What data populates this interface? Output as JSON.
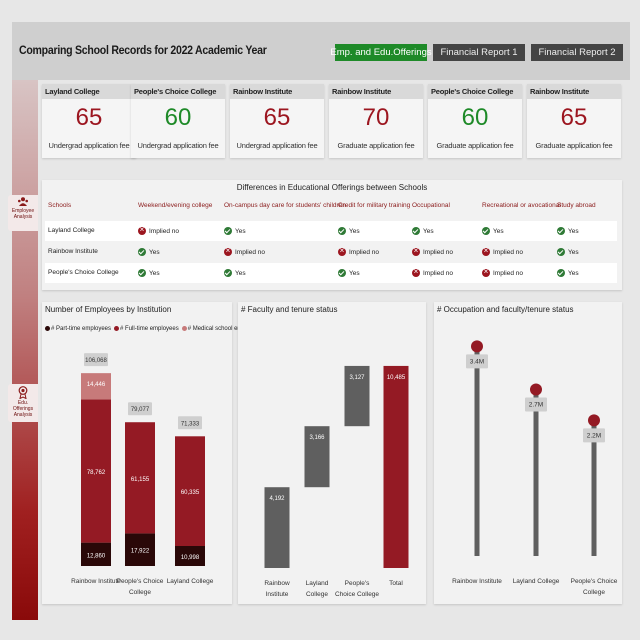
{
  "header": {
    "title": "Comparing School Records for 2022 Academic Year",
    "nav": [
      {
        "label": "Emp. and Edu.Offerings",
        "active": true
      },
      {
        "label": "Financial Report 1",
        "active": false
      },
      {
        "label": "Financial Report 2",
        "active": false
      }
    ]
  },
  "sidebar": {
    "employees_label": "Employee Analysis",
    "edu_label": "Edu. Offerings Analysis"
  },
  "cards": [
    {
      "school": "Layland College",
      "value": "65",
      "label": "Undergrad application fee",
      "color": "#9c1620"
    },
    {
      "school": "People's Choice College",
      "value": "60",
      "label": "Undergrad application fee",
      "color": "#1e8a28"
    },
    {
      "school": "Rainbow Institute",
      "value": "65",
      "label": "Undergrad application fee",
      "color": "#9c1620"
    },
    {
      "school": "Rainbow Institute",
      "value": "70",
      "label": "Graduate application fee",
      "color": "#9c1620"
    },
    {
      "school": "People's Choice College",
      "value": "60",
      "label": "Graduate application fee",
      "color": "#1e8a28"
    },
    {
      "school": "Rainbow Institute",
      "value": "65",
      "label": "Graduate application fee",
      "color": "#9c1620"
    }
  ],
  "offerings_table": {
    "title": "Differences in Educational Offerings between Schools",
    "columns": [
      "Schools",
      "Weekend/evening college",
      "On-campus day care for students' children",
      "Credit for military training",
      "Occupational",
      "Recreational or avocational",
      "Study abroad"
    ],
    "rows": [
      {
        "school": "Layland College",
        "cells": [
          {
            "text": "Implied no",
            "status": "no"
          },
          {
            "text": "Yes",
            "status": "yes"
          },
          {
            "text": "Yes",
            "status": "yes"
          },
          {
            "text": "Yes",
            "status": "yes"
          },
          {
            "text": "Yes",
            "status": "yes"
          },
          {
            "text": "Yes",
            "status": "yes"
          }
        ]
      },
      {
        "school": "Rainbow Institute",
        "cells": [
          {
            "text": "Yes",
            "status": "yes"
          },
          {
            "text": "Implied no",
            "status": "no"
          },
          {
            "text": "Implied no",
            "status": "no"
          },
          {
            "text": "Implied no",
            "status": "no"
          },
          {
            "text": "Implied no",
            "status": "no"
          },
          {
            "text": "Yes",
            "status": "yes"
          }
        ]
      },
      {
        "school": "People's Choice College",
        "cells": [
          {
            "text": "Yes",
            "status": "yes"
          },
          {
            "text": "Yes",
            "status": "yes"
          },
          {
            "text": "Yes",
            "status": "yes"
          },
          {
            "text": "Implied no",
            "status": "no"
          },
          {
            "text": "Implied no",
            "status": "no"
          },
          {
            "text": "Yes",
            "status": "yes"
          }
        ]
      }
    ]
  },
  "panels": {
    "employees_title": "Number of Employees by Institution",
    "faculty_title": "# Faculty and tenure status",
    "occupation_title": "# Occupation and faculty/tenure status"
  },
  "chart_data": [
    {
      "type": "bar",
      "stacked": true,
      "title": "Number of Employees by Institution",
      "categories": [
        "Rainbow Institute",
        "People's Choice College",
        "Layland College"
      ],
      "category_lines": [
        [
          "Rainbow Institute"
        ],
        [
          "People's Choice",
          "College"
        ],
        [
          "Layland College"
        ]
      ],
      "series": [
        {
          "name": "# Part-time employees",
          "values": [
            12860,
            17922,
            10998
          ],
          "labels": [
            "12,860",
            "17,922",
            "10,998"
          ],
          "color": "#2a0808"
        },
        {
          "name": "# Full-time employees",
          "values": [
            78762,
            61155,
            60335
          ],
          "labels": [
            "78,762",
            "61,155",
            "60,335"
          ],
          "color": "#941a24"
        },
        {
          "name": "# Medical school empl...",
          "values": [
            14446,
            0,
            0
          ],
          "labels": [
            "14,446",
            "",
            ""
          ],
          "color": "#c77a7a"
        }
      ],
      "totals": [
        106068,
        79077,
        71333
      ],
      "total_labels": [
        "106,068",
        "79,077",
        "71,333"
      ],
      "ylim": [
        0,
        110000
      ]
    },
    {
      "type": "bar",
      "subtype": "waterfall",
      "title": "# Faculty and tenure status",
      "categories": [
        "Rainbow Institute",
        "Layland College",
        "People's Choice College",
        "Total"
      ],
      "category_lines": [
        [
          "Rainbow",
          "Institute"
        ],
        [
          "Layland",
          "College"
        ],
        [
          "People's",
          "Choice College"
        ],
        [
          "Total"
        ]
      ],
      "values": [
        4192,
        3166,
        3127,
        10485
      ],
      "labels": [
        "4,192",
        "3,166",
        "3,127",
        "10,485"
      ],
      "colors": [
        "#5f5f5f",
        "#5f5f5f",
        "#5f5f5f",
        "#941a24"
      ],
      "ylim": [
        0,
        11000
      ]
    },
    {
      "type": "scatter",
      "subtype": "lollipop",
      "title": "# Occupation and faculty/tenure status",
      "categories": [
        "Rainbow Institute",
        "Layland College",
        "People's Choice College"
      ],
      "category_lines": [
        [
          "Rainbow Institute"
        ],
        [
          "Layland College"
        ],
        [
          "People's Choice",
          "College"
        ]
      ],
      "values": [
        3.4,
        2.7,
        2.2
      ],
      "labels": [
        "3.4M",
        "2.7M",
        "2.2M"
      ],
      "unit": "M",
      "ylim": [
        0,
        3.6
      ]
    }
  ]
}
